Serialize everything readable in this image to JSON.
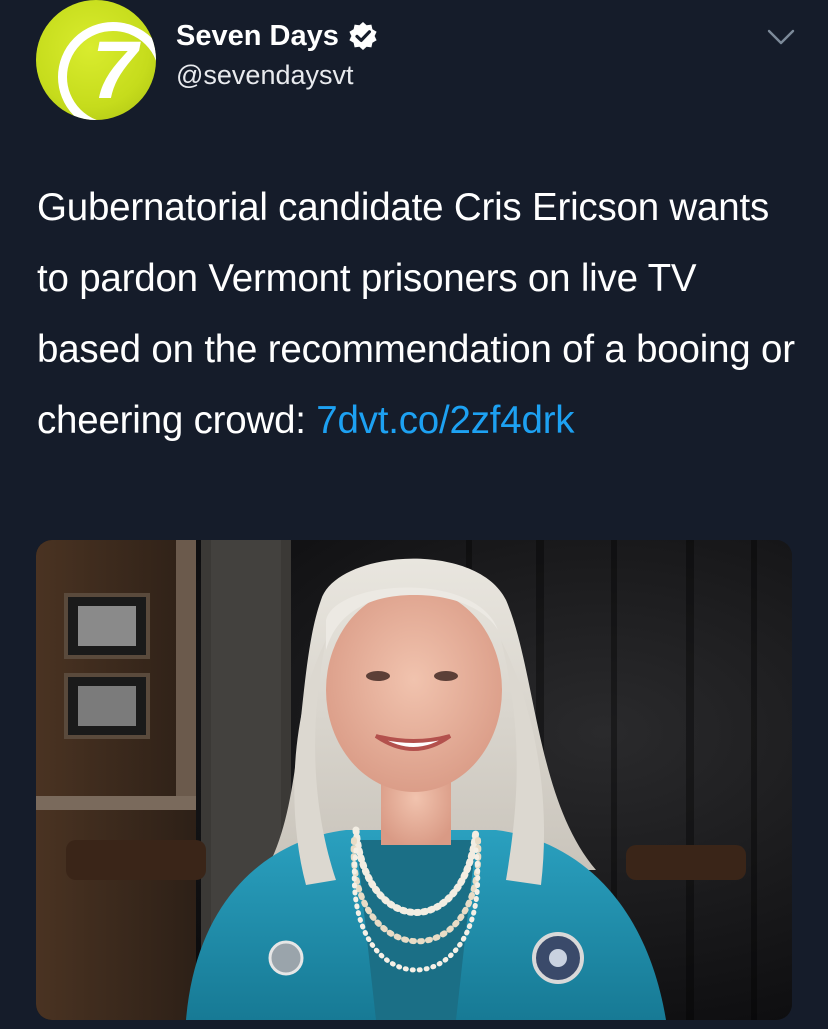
{
  "account": {
    "display_name": "Seven Days",
    "handle": "@sevendaysvt",
    "avatar_text": "7",
    "verified": true
  },
  "tweet": {
    "text": "Gubernatorial candidate Cris Ericson wants to pardon Vermont prisoners on live TV based on the recommendation of a booing or cheering crowd: ",
    "link": "7dvt.co/2zf4drk"
  },
  "icons": {
    "verified": "verified-badge-icon",
    "menu": "chevron-down-icon"
  },
  "colors": {
    "background": "#151c2a",
    "link": "#1da1f2",
    "avatar": "#c6dc1c",
    "jacket": "#1e8aa6"
  }
}
